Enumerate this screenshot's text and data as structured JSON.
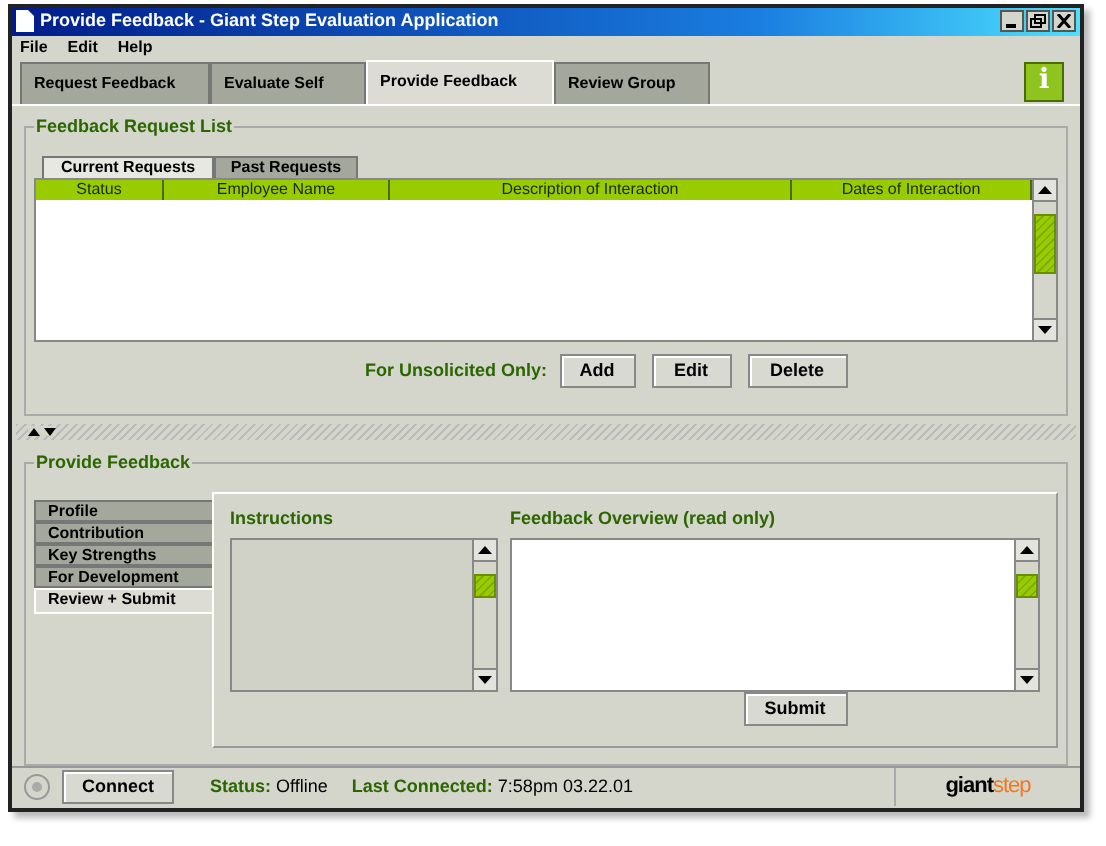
{
  "window": {
    "title": "Provide Feedback - Giant Step Evaluation Application"
  },
  "menu": [
    "File",
    "Edit",
    "Help"
  ],
  "tabs": [
    {
      "label": "Request Feedback",
      "selected": false
    },
    {
      "label": "Evaluate Self",
      "selected": false
    },
    {
      "label": "Provide Feedback",
      "selected": true
    },
    {
      "label": "Review Group",
      "selected": false
    }
  ],
  "info_button": {
    "label": "i"
  },
  "request_list": {
    "title": "Feedback Request List",
    "tabs": [
      {
        "label": "Current Requests",
        "selected": true
      },
      {
        "label": "Past Requests",
        "selected": false
      }
    ],
    "columns": [
      "Status",
      "Employee Name",
      "Description of Interaction",
      "Dates of Interaction"
    ],
    "actions_label": "For Unsolicited Only:",
    "buttons": [
      "Add",
      "Edit",
      "Delete"
    ]
  },
  "provide": {
    "title": "Provide Feedback",
    "sections": [
      {
        "label": "Profile",
        "selected": false
      },
      {
        "label": "Contribution",
        "selected": false
      },
      {
        "label": "Key Strengths",
        "selected": false
      },
      {
        "label": "For Development",
        "selected": false
      },
      {
        "label": "Review + Submit",
        "selected": true
      }
    ],
    "instructions_label": "Instructions",
    "overview_label": "Feedback Overview (read only)",
    "submit": "Submit"
  },
  "status_bar": {
    "connect": "Connect",
    "status_label": "Status:",
    "status": "Offline",
    "last_label": "Last Connected:",
    "last": "7:58pm 03.22.01",
    "logo_1": "giant",
    "logo_2": "step"
  }
}
